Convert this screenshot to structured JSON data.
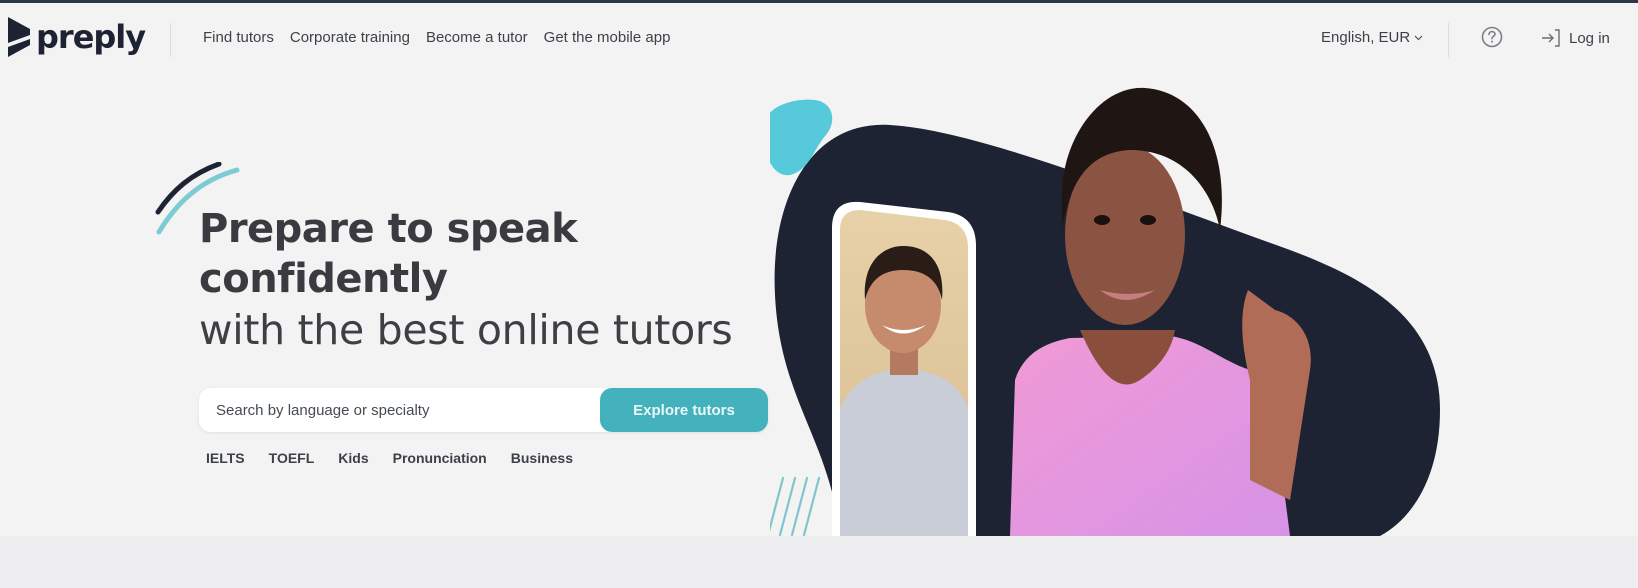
{
  "header": {
    "logo_text": "preply",
    "nav": [
      {
        "label": "Find tutors"
      },
      {
        "label": "Corporate training"
      },
      {
        "label": "Become a tutor"
      },
      {
        "label": "Get the mobile app"
      }
    ],
    "language_currency": "English, EUR",
    "help_icon": "question-circle-icon",
    "login_label": "Log in",
    "login_icon": "sign-in-arrow-icon"
  },
  "hero": {
    "headline_bold_line1": "Prepare to speak",
    "headline_bold_line2": "confidently",
    "headline_light": "with the best online tutors",
    "search": {
      "placeholder": "Search by language or specialty",
      "value": "",
      "button_label": "Explore tutors"
    },
    "chips": [
      {
        "label": "IELTS"
      },
      {
        "label": "TOEFL"
      },
      {
        "label": "Kids"
      },
      {
        "label": "Pronunciation"
      },
      {
        "label": "Business"
      }
    ],
    "images": {
      "main_tutor": "smiling-woman-pink-sweater-photo",
      "inset_tutor": "smiling-man-video-call-photo"
    }
  },
  "colors": {
    "accent_teal": "#43b2bd",
    "dark_navy": "#1e2333",
    "light_teal_blob": "#56c9db",
    "background": "#f3f3f4"
  }
}
